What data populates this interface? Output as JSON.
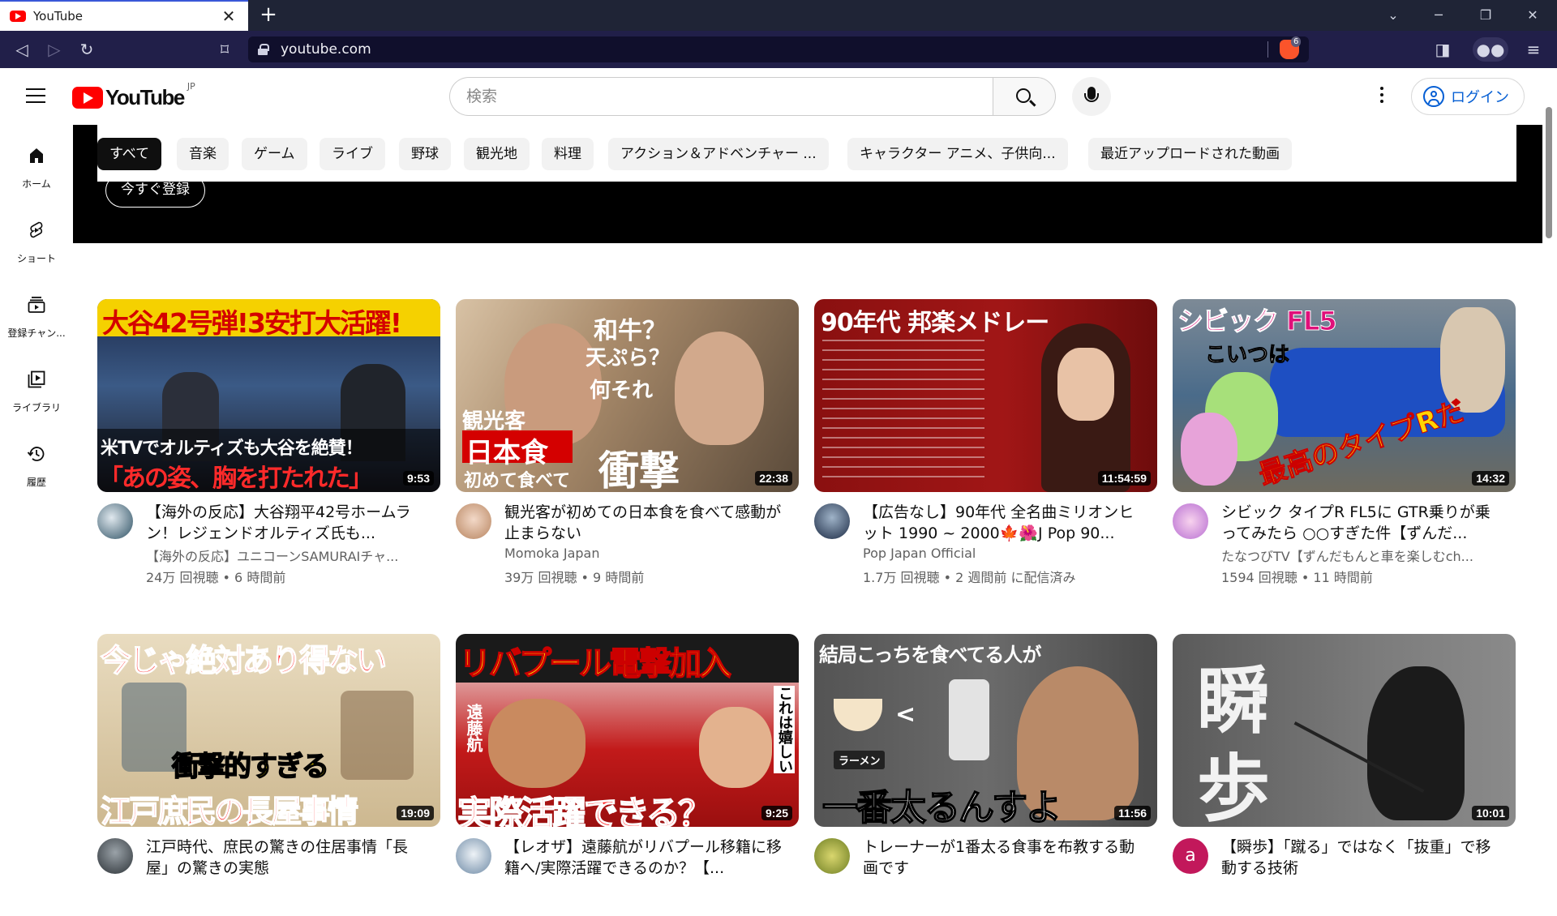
{
  "browser": {
    "tab_title": "YouTube",
    "tab_close": "✕",
    "new_tab": "+",
    "url": "youtube.com",
    "shields_count": "6"
  },
  "masthead": {
    "logo_text": "YouTube",
    "country_code": "JP",
    "search_placeholder": "検索",
    "login_label": "ログイン"
  },
  "guide": {
    "items": [
      {
        "label": "ホーム",
        "icon": "home-icon"
      },
      {
        "label": "ショート",
        "icon": "shorts-icon"
      },
      {
        "label": "登録チャン...",
        "icon": "subscriptions-icon"
      },
      {
        "label": "ライブラリ",
        "icon": "library-icon"
      },
      {
        "label": "履歴",
        "icon": "history-icon"
      }
    ]
  },
  "chips": [
    "すべて",
    "音楽",
    "ゲーム",
    "ライブ",
    "野球",
    "観光地",
    "料理",
    "アクション＆アドベンチャー ...",
    "キャラクター アニメ、子供向...",
    "最近アップロードされた動画"
  ],
  "banner": {
    "subscribe_label": "今すぐ登録"
  },
  "videos": [
    {
      "title": "【海外の反応】大谷翔平42号ホームラン！レジェンドオルティズ氏も...",
      "channel": "【海外の反応】ユニコーンSAMURAIチャ...",
      "stats": "24万 回視聴 • 6 時間前",
      "duration": "9:53",
      "thumb_lines": [
        "大谷42号弾!3安打大活躍!",
        "米TVでオルティズも大谷を絶賛！",
        "「あの姿、胸を打たれた」"
      ]
    },
    {
      "title": "観光客が初めての日本食を食べて感動が止まらない",
      "channel": "Momoka Japan",
      "stats": "39万 回視聴 • 9 時間前",
      "duration": "22:38",
      "thumb_lines": [
        "和牛？",
        "天ぷら？",
        "何それ",
        "観光客",
        "日本食",
        "初めて食べて",
        "衝撃"
      ]
    },
    {
      "title": "【広告なし】90年代 全名曲ミリオンヒット 1990 ~ 2000🍁🌺J Pop 90...",
      "channel": "Pop Japan Official",
      "stats": "1.7万 回視聴 • 2 週間前 に配信済み",
      "duration": "11:54:59",
      "thumb_lines": [
        "90年代 邦楽メドレー"
      ]
    },
    {
      "title": "シビック タイプR FL5に GTR乗りが乗ってみたら ○○すぎた件【ずんだ...",
      "channel": "たなつびTV【ずんだもんと車を楽しむch...",
      "stats": "1594 回視聴 • 11 時間前",
      "duration": "14:32",
      "thumb_lines": [
        "シビック FL5",
        "こいつは",
        "最高のタイプRだ"
      ]
    },
    {
      "title": "江戸時代、庶民の驚きの住居事情「長屋」の驚きの実態",
      "channel": "",
      "stats": "",
      "duration": "19:09",
      "thumb_lines": [
        "今じゃ絶対あり得ない",
        "衝撃的すぎる",
        "江戸庶民の長屋事情"
      ]
    },
    {
      "title": "【レオザ】遠藤航がリバプール移籍に移籍へ/実際活躍できるのか？【...",
      "channel": "",
      "stats": "",
      "duration": "9:25",
      "thumb_lines": [
        "リバプール電撃加入",
        "実際活躍できる？",
        "遠藤航",
        "これは嬉しい"
      ]
    },
    {
      "title": "トレーナーが1番太る食事を布教する動画です",
      "channel": "",
      "stats": "",
      "duration": "11:56",
      "thumb_lines": [
        "結局こっちを食べてる人が",
        "一番太るんすよ",
        "ラーメン"
      ]
    },
    {
      "title": "【瞬歩】「蹴る」ではなく「抜重」で移動する技術",
      "channel": "",
      "stats": "",
      "duration": "10:01",
      "thumb_lines": [
        "瞬",
        "歩"
      ],
      "avatar_letter": "a"
    }
  ],
  "colors": {
    "youtube_red": "#ff0000",
    "link_blue": "#065fd4",
    "browser_navbar": "#211f49"
  }
}
